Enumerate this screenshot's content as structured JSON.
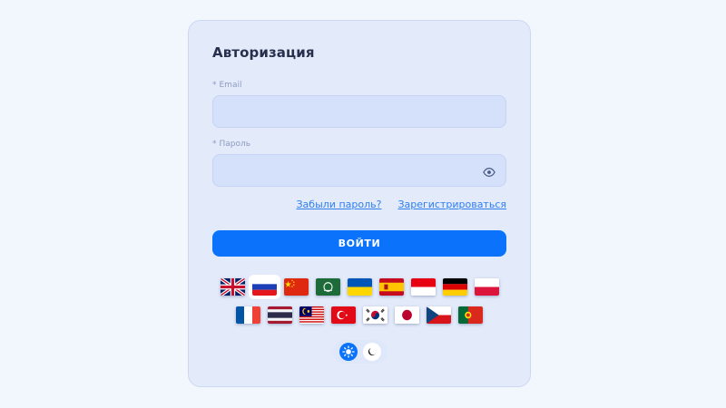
{
  "form": {
    "title": "Авторизация",
    "email_label": "Email",
    "email_value": "",
    "password_label": "Пароль",
    "password_value": "",
    "required_mark": "*"
  },
  "links": {
    "forgot": "Забыли пароль?",
    "register": "Зарегистрироваться"
  },
  "submit_label": "ВОЙТИ",
  "languages": {
    "row1": [
      "gb",
      "ru",
      "cn",
      "sa",
      "ua",
      "es",
      "id",
      "de",
      "pl"
    ],
    "row2": [
      "fr",
      "th",
      "my",
      "tr",
      "kr",
      "jp",
      "cz",
      "pt"
    ],
    "selected": "ru"
  },
  "theme": {
    "options": [
      "sun-icon",
      "moon-icon"
    ],
    "active": "sun-icon"
  },
  "colors": {
    "accent": "#0a72fb",
    "card": "#e3ebfb",
    "field": "#d5e0fa",
    "link": "#2f7ef0"
  }
}
